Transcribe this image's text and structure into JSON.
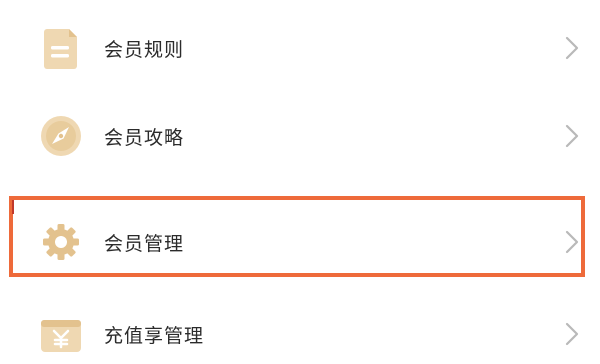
{
  "menu": {
    "items": [
      {
        "label": "会员规则",
        "icon": "document-icon"
      },
      {
        "label": "会员攻略",
        "icon": "compass-icon"
      },
      {
        "label": "会员管理",
        "icon": "gear-icon"
      },
      {
        "label": "充值享管理",
        "icon": "yuan-card-icon"
      }
    ],
    "highlighted_index": 2
  },
  "colors": {
    "icon_gold": "#e3c28e",
    "icon_gold_light": "#efd8b2",
    "highlight": "#ee6a3a",
    "chevron": "#b9b9b9",
    "text": "#2b2b2b"
  }
}
